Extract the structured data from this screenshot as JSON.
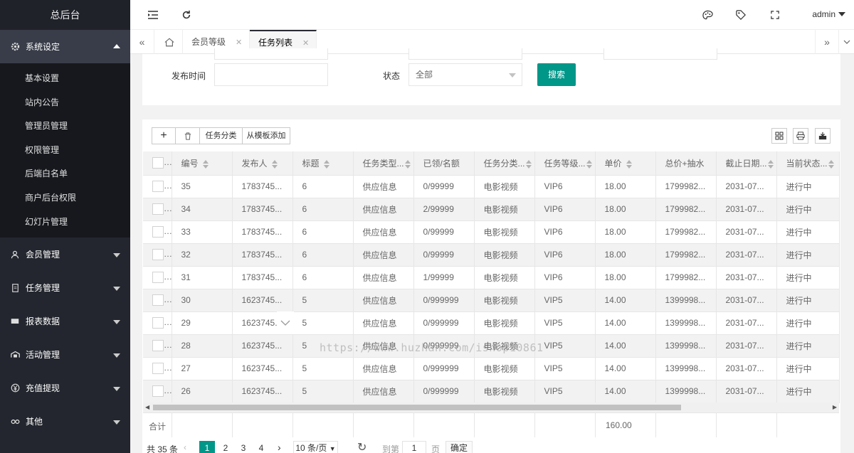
{
  "app": {
    "title": "总后台",
    "user": "admin"
  },
  "sidebar": {
    "groups": [
      {
        "label": "系统设定",
        "icon": "gear-icon",
        "expanded": true,
        "items": [
          "基本设置",
          "站内公告",
          "管理员管理",
          "权限管理",
          "后端白名单",
          "商户后台权限",
          "幻灯片管理"
        ]
      },
      {
        "label": "会员管理",
        "icon": "user-icon"
      },
      {
        "label": "任务管理",
        "icon": "document-icon"
      },
      {
        "label": "报表数据",
        "icon": "report-icon"
      },
      {
        "label": "活动管理",
        "icon": "activity-icon"
      },
      {
        "label": "充值提现",
        "icon": "yen-icon"
      },
      {
        "label": "其他",
        "icon": "link-icon"
      }
    ]
  },
  "tabs": {
    "items": [
      {
        "label": "会员等级"
      },
      {
        "label": "任务列表"
      }
    ]
  },
  "search": {
    "publish_time_label": "发布时间",
    "status_label": "状态",
    "status_value": "全部",
    "search_button": "搜索"
  },
  "toolbar": {
    "category_label": "任务分类",
    "template_label": "从模板添加"
  },
  "table": {
    "headers": [
      "编号",
      "发布人",
      "标题",
      "任务类型...",
      "已领/名额",
      "任务分类...",
      "任务等级...",
      "单价",
      "总价+抽水",
      "截止日期...",
      "当前状态..."
    ],
    "rows": [
      [
        "35",
        "1783745...",
        "6",
        "供应信息",
        "0/99999",
        "电影视频",
        "VIP6",
        "18.00",
        "1799982...",
        "2031-07...",
        "进行中"
      ],
      [
        "34",
        "1783745...",
        "6",
        "供应信息",
        "2/99999",
        "电影视频",
        "VIP6",
        "18.00",
        "1799982...",
        "2031-07...",
        "进行中"
      ],
      [
        "33",
        "1783745...",
        "6",
        "供应信息",
        "0/99999",
        "电影视频",
        "VIP6",
        "18.00",
        "1799982...",
        "2031-07...",
        "进行中"
      ],
      [
        "32",
        "1783745...",
        "6",
        "供应信息",
        "0/99999",
        "电影视频",
        "VIP6",
        "18.00",
        "1799982...",
        "2031-07...",
        "进行中"
      ],
      [
        "31",
        "1783745...",
        "6",
        "供应信息",
        "1/99999",
        "电影视频",
        "VIP6",
        "18.00",
        "1799982...",
        "2031-07...",
        "进行中"
      ],
      [
        "30",
        "1623745...",
        "5",
        "供应信息",
        "0/999999",
        "电影视频",
        "VIP5",
        "14.00",
        "1399998...",
        "2031-07...",
        "进行中"
      ],
      [
        "29",
        "1623745...",
        "5",
        "供应信息",
        "0/999999",
        "电影视频",
        "VIP5",
        "14.00",
        "1399998...",
        "2031-07...",
        "进行中"
      ],
      [
        "28",
        "1623745...",
        "5",
        "供应信息",
        "0/999999",
        "电影视频",
        "VIP5",
        "14.00",
        "1399998...",
        "2031-07...",
        "进行中"
      ],
      [
        "27",
        "1623745...",
        "5",
        "供应信息",
        "0/999999",
        "电影视频",
        "VIP5",
        "14.00",
        "1399998...",
        "2031-07...",
        "进行中"
      ],
      [
        "26",
        "1623745...",
        "5",
        "供应信息",
        "0/999999",
        "电影视频",
        "VIP5",
        "14.00",
        "1399998...",
        "2031-07...",
        "进行中"
      ]
    ],
    "total_label": "合计",
    "total_price": "160.00"
  },
  "pager": {
    "total": "共 35 条",
    "pages": [
      "1",
      "2",
      "3",
      "4"
    ],
    "per_page": "10 条/页",
    "goto_label": "到第",
    "goto_value": "1",
    "page_unit": "页",
    "confirm": "确定"
  },
  "watermark": "https://www.huzhan.com/ishop10861",
  "colors": {
    "accent": "#009688",
    "sidebar": "#23262e"
  }
}
